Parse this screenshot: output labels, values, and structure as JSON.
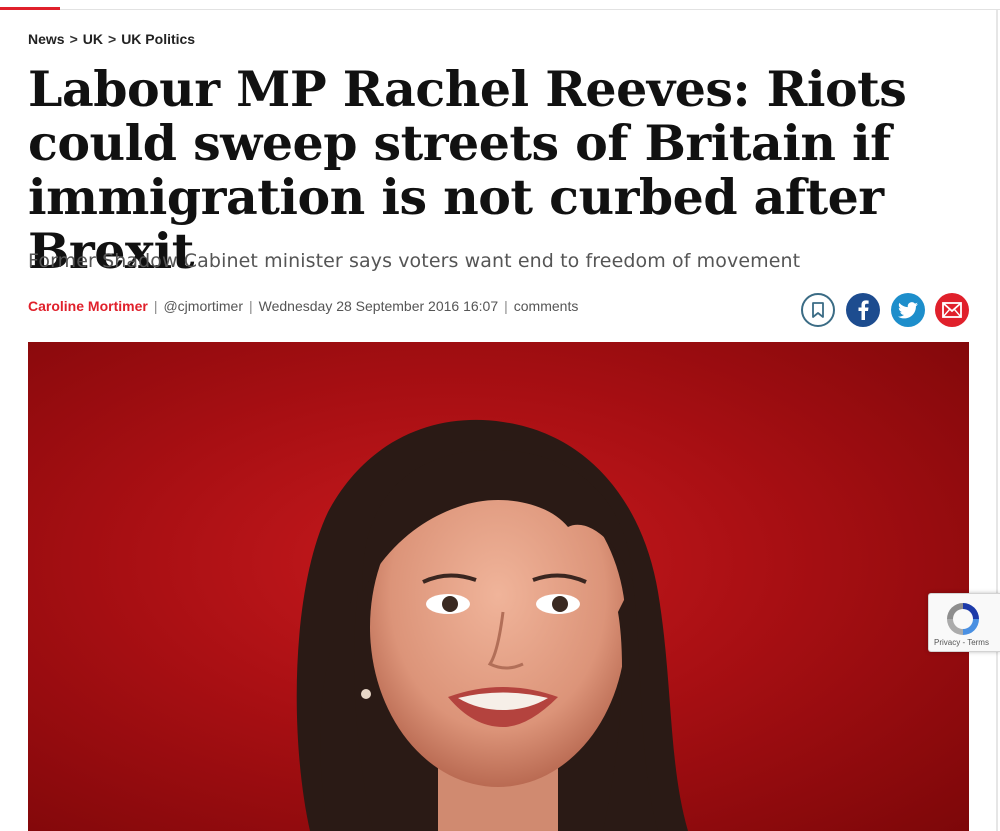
{
  "breadcrumb": {
    "items": [
      "News",
      "UK",
      "UK Politics"
    ],
    "separator": ">"
  },
  "article": {
    "headline": "Labour MP Rachel Reeves: Riots could sweep streets of Britain if immigration is not curbed after Brexit",
    "standfirst": "Former Shadow Cabinet minister says voters want end to freedom of movement",
    "author": "Caroline Mortimer",
    "handle": "@cjmortimer",
    "datetime": "Wednesday 28 September 2016 16:07",
    "comments_label": "comments",
    "byline_separator": "|"
  },
  "share": {
    "icons": [
      "bookmark-icon",
      "facebook-icon",
      "twitter-icon",
      "email-icon"
    ]
  },
  "recaptcha": {
    "terms": "Privacy - Terms"
  },
  "colors": {
    "accent": "#e0202b",
    "facebook": "#1d4c8f",
    "twitter": "#1d8ecb",
    "bookmark_ring": "#3b6c85",
    "hero_bg": "#b0141a"
  }
}
